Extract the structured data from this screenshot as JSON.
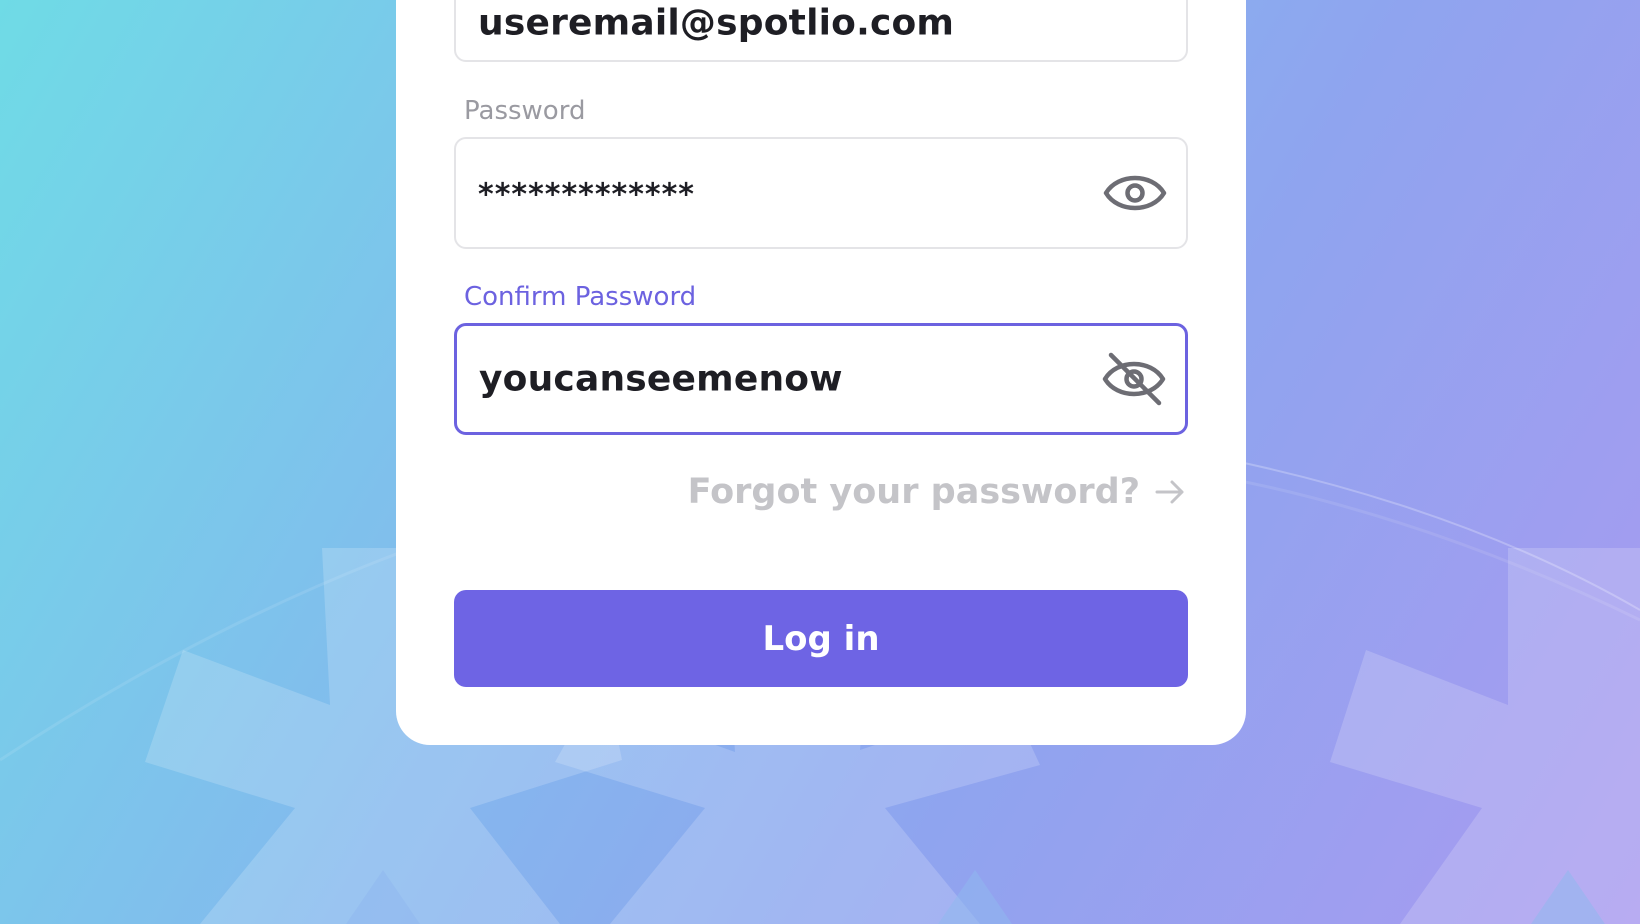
{
  "form": {
    "email_value": "useremail@spotlio.com",
    "password_label": "Password",
    "password_value": "*************",
    "password_toggle_icon": "eye-icon",
    "confirm_label": "Confirm Password",
    "confirm_value": "youcanseemenow",
    "confirm_toggle_icon": "eye-off-icon",
    "forgot_link": "Forgot your password?",
    "forgot_icon": "arrow-right-icon",
    "login_button": "Log in"
  },
  "colors": {
    "accent": "#6c62e0",
    "button": "#6e64e4",
    "label_muted": "#9a9aa1",
    "link_muted": "#c4c4c8"
  }
}
